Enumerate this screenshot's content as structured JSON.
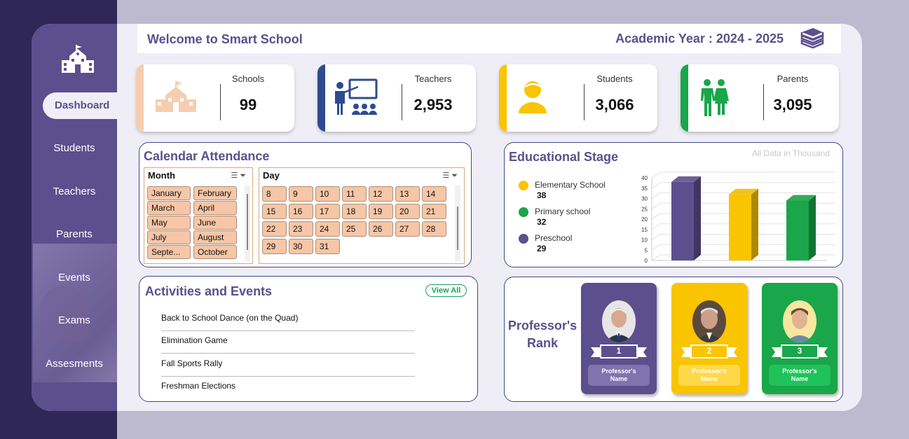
{
  "header": {
    "title": "Welcome to Smart School",
    "academic_year": "Academic Year : 2024 - 2025"
  },
  "sidebar": {
    "active": "Dashboard",
    "items": [
      "Students",
      "Teachers",
      "Parents",
      "Events",
      "Exams",
      "Assesments"
    ]
  },
  "kpis": [
    {
      "label": "Schools",
      "value": "99",
      "color": "#f7cdb0"
    },
    {
      "label": "Teachers",
      "value": "2,953",
      "color": "#2f4b8f"
    },
    {
      "label": "Students",
      "value": "3,066",
      "color": "#f9c400"
    },
    {
      "label": "Parents",
      "value": "3,095",
      "color": "#1aa64a"
    }
  ],
  "calendar": {
    "title": "Calendar Attendance",
    "month_header": "Month",
    "day_header": "Day",
    "months": [
      "January",
      "February",
      "March",
      "April",
      "May",
      "June",
      "July",
      "August",
      "Septe...",
      "October"
    ],
    "days": [
      "8",
      "9",
      "10",
      "11",
      "12",
      "13",
      "14",
      "15",
      "16",
      "17",
      "18",
      "19",
      "20",
      "21",
      "22",
      "23",
      "24",
      "25",
      "26",
      "27",
      "28",
      "29",
      "30",
      "31"
    ]
  },
  "stage": {
    "title": "Educational Stage",
    "note": "All Data in Thousand",
    "legend": [
      {
        "name": "Elementary School",
        "value": "38",
        "color": "#5b4f8e"
      },
      {
        "name": "Primary school",
        "value": "32",
        "color": "#f9c400"
      },
      {
        "name": "Preschool",
        "value": "29",
        "color": "#1aa64a"
      }
    ]
  },
  "legend_dot_colors": [
    "#f9c400",
    "#1aa64a",
    "#5b4f8e"
  ],
  "chart_data": {
    "type": "bar",
    "categories": [
      "Elementary School",
      "Primary school",
      "Preschool"
    ],
    "values": [
      38,
      32,
      29
    ],
    "colors": [
      "#5b4f8e",
      "#f9c400",
      "#1aa64a"
    ],
    "title": "Educational Stage",
    "xlabel": "",
    "ylabel": "",
    "ylim": [
      0,
      40
    ],
    "yticks": [
      "0",
      "5",
      "10",
      "15",
      "20",
      "25",
      "30",
      "35",
      "40"
    ],
    "grid": true
  },
  "activities": {
    "title": "Activities and Events",
    "view_all": "View All",
    "events": [
      "Back to School Dance (on the Quad)",
      "Elimination Game",
      "Fall Sports Rally",
      "Freshman Elections"
    ]
  },
  "professors": {
    "title_line1": "Professor's",
    "title_line2": "Rank",
    "cards": [
      {
        "rank": "1",
        "name_line1": "Professor's",
        "name_line2": "Name",
        "color": "#5b4f8e"
      },
      {
        "rank": "2",
        "name_line1": "Professor's",
        "name_line2": "Name",
        "color": "#f9c400"
      },
      {
        "rank": "3",
        "name_line1": "Professor's",
        "name_line2": "Name",
        "color": "#1aa64a"
      }
    ]
  }
}
